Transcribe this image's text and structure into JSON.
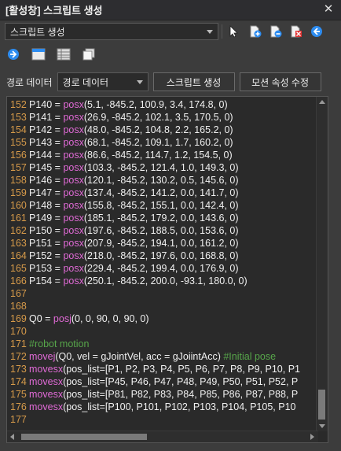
{
  "window": {
    "title": "[활성창] 스크립트 생성"
  },
  "toolbar": {
    "dropdown_value": "스크립트 생성",
    "icons": [
      "pointer-icon",
      "add-icon",
      "remove-icon",
      "delete-icon",
      "back-icon",
      "forward-icon",
      "window-icon",
      "grid-icon",
      "copy-icon"
    ]
  },
  "path": {
    "label": "경로 데이터",
    "select_value": "경로 데이터",
    "generate_button": "스크립트 생성",
    "edit_motion_button": "모션 속성 수정"
  },
  "code": {
    "lines": [
      {
        "n": "152",
        "parts": [
          [
            "P140 = ",
            "txt"
          ],
          [
            "posx",
            "kw"
          ],
          [
            "(5.1, -845.2, 100.9, 3.4, 174.8, 0)",
            "txt"
          ]
        ]
      },
      {
        "n": "153",
        "parts": [
          [
            "P141 = ",
            "txt"
          ],
          [
            "posx",
            "kw"
          ],
          [
            "(26.9, -845.2, 102.1, 3.5, 170.5, 0)",
            "txt"
          ]
        ]
      },
      {
        "n": "154",
        "parts": [
          [
            "P142 = ",
            "txt"
          ],
          [
            "posx",
            "kw"
          ],
          [
            "(48.0, -845.2, 104.8, 2.2, 165.2, 0)",
            "txt"
          ]
        ]
      },
      {
        "n": "155",
        "parts": [
          [
            "P143 = ",
            "txt"
          ],
          [
            "posx",
            "kw"
          ],
          [
            "(68.1, -845.2, 109.1, 1.7, 160.2, 0)",
            "txt"
          ]
        ]
      },
      {
        "n": "156",
        "parts": [
          [
            "P144 = ",
            "txt"
          ],
          [
            "posx",
            "kw"
          ],
          [
            "(86.6, -845.2, 114.7, 1.2, 154.5, 0)",
            "txt"
          ]
        ]
      },
      {
        "n": "157",
        "parts": [
          [
            "P145 = ",
            "txt"
          ],
          [
            "posx",
            "kw"
          ],
          [
            "(103.3, -845.2, 121.4, 1.0, 149.3, 0)",
            "txt"
          ]
        ]
      },
      {
        "n": "158",
        "parts": [
          [
            "P146 = ",
            "txt"
          ],
          [
            "posx",
            "kw"
          ],
          [
            "(120.1, -845.2, 130.2, 0.5, 145.6, 0)",
            "txt"
          ]
        ]
      },
      {
        "n": "159",
        "parts": [
          [
            "P147 = ",
            "txt"
          ],
          [
            "posx",
            "kw"
          ],
          [
            "(137.4, -845.2, 141.2, 0.0, 141.7, 0)",
            "txt"
          ]
        ]
      },
      {
        "n": "160",
        "parts": [
          [
            "P148 = ",
            "txt"
          ],
          [
            "posx",
            "kw"
          ],
          [
            "(155.8, -845.2, 155.1, 0.0, 142.4, 0)",
            "txt"
          ]
        ]
      },
      {
        "n": "161",
        "parts": [
          [
            "P149 = ",
            "txt"
          ],
          [
            "posx",
            "kw"
          ],
          [
            "(185.1, -845.2, 179.2, 0.0, 143.6, 0)",
            "txt"
          ]
        ]
      },
      {
        "n": "162",
        "parts": [
          [
            "P150 = ",
            "txt"
          ],
          [
            "posx",
            "kw"
          ],
          [
            "(197.6, -845.2, 188.5, 0.0, 153.6, 0)",
            "txt"
          ]
        ]
      },
      {
        "n": "163",
        "parts": [
          [
            "P151 = ",
            "txt"
          ],
          [
            "posx",
            "kw"
          ],
          [
            "(207.9, -845.2, 194.1, 0.0, 161.2, 0)",
            "txt"
          ]
        ]
      },
      {
        "n": "164",
        "parts": [
          [
            "P152 = ",
            "txt"
          ],
          [
            "posx",
            "kw"
          ],
          [
            "(218.0, -845.2, 197.6, 0.0, 168.8, 0)",
            "txt"
          ]
        ]
      },
      {
        "n": "165",
        "parts": [
          [
            "P153 = ",
            "txt"
          ],
          [
            "posx",
            "kw"
          ],
          [
            "(229.4, -845.2, 199.4, 0.0, 176.9, 0)",
            "txt"
          ]
        ]
      },
      {
        "n": "166",
        "parts": [
          [
            "P154 = ",
            "txt"
          ],
          [
            "posx",
            "kw"
          ],
          [
            "(250.1, -845.2, 200.0, -93.1, 180.0, 0)",
            "txt"
          ]
        ]
      },
      {
        "n": "167",
        "parts": []
      },
      {
        "n": "168",
        "parts": []
      },
      {
        "n": "169",
        "parts": [
          [
            "Q0 = ",
            "txt"
          ],
          [
            "posj",
            "kw"
          ],
          [
            "(0, 0, 90, 0, 90, 0)",
            "txt"
          ]
        ]
      },
      {
        "n": "170",
        "parts": []
      },
      {
        "n": "171",
        "parts": [
          [
            "#robot motion",
            "cm"
          ]
        ]
      },
      {
        "n": "172",
        "parts": [
          [
            "movej",
            "kw"
          ],
          [
            "(Q0, vel = gJointVel, acc = gJoiintAcc) ",
            "txt"
          ],
          [
            "#Initial pose",
            "cm"
          ]
        ]
      },
      {
        "n": "173",
        "parts": [
          [
            "movesx",
            "kw"
          ],
          [
            "(pos_list=[P1, P2, P3, P4, P5, P6, P7, P8, P9, P10, P1",
            "txt"
          ]
        ]
      },
      {
        "n": "174",
        "parts": [
          [
            "movesx",
            "kw"
          ],
          [
            "(pos_list=[P45, P46, P47, P48, P49, P50, P51, P52, P",
            "txt"
          ]
        ]
      },
      {
        "n": "175",
        "parts": [
          [
            "movesx",
            "kw"
          ],
          [
            "(pos_list=[P81, P82, P83, P84, P85, P86, P87, P88, P",
            "txt"
          ]
        ]
      },
      {
        "n": "176",
        "parts": [
          [
            "movesx",
            "kw"
          ],
          [
            "(pos_list=[P100, P101, P102, P103, P104, P105, P10",
            "txt"
          ]
        ]
      },
      {
        "n": "177",
        "parts": []
      }
    ]
  },
  "colors": {
    "line_number": "#d69a4a",
    "keyword": "#e06ad6",
    "comment": "#57a64a",
    "text": "#f0f0f0",
    "background": "#2a2a2a",
    "accent_add": "#2d8cf0",
    "accent_delete": "#e03030"
  }
}
